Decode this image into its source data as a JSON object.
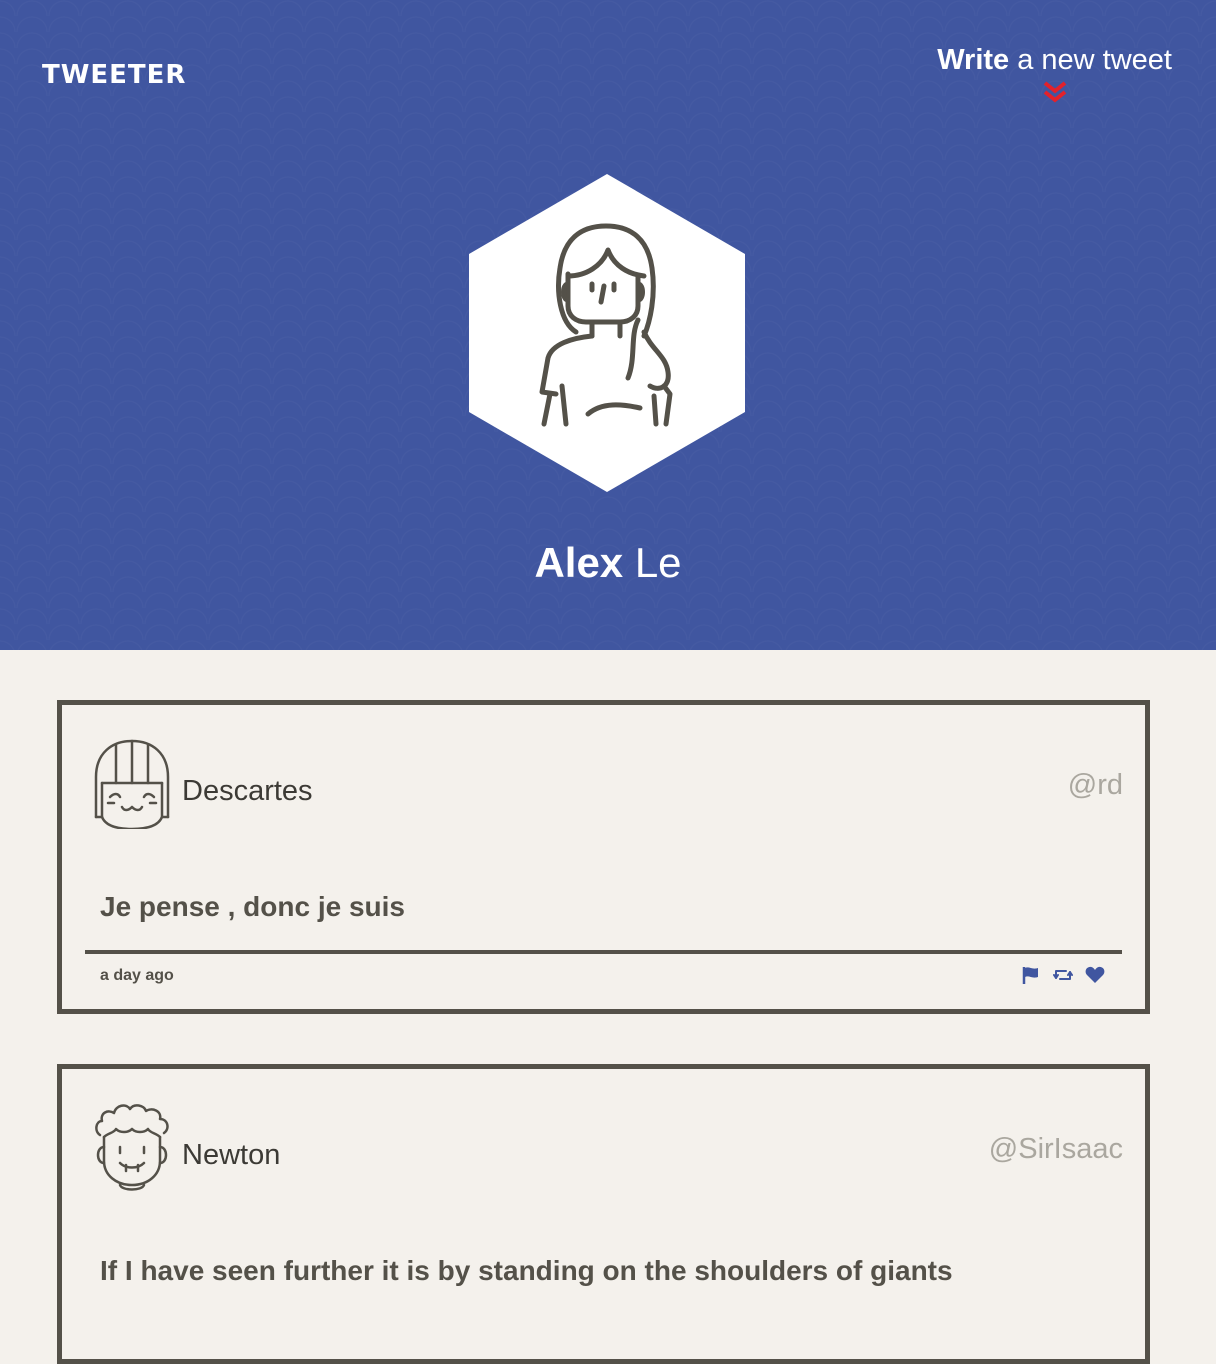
{
  "header": {
    "logo": "TWEETER",
    "compose_strong": "Write",
    "compose_rest": " a new tweet",
    "compose_icon": "chevron-double-down-icon",
    "accent_color": "#e3212b",
    "background_color": "#4056a0"
  },
  "profile": {
    "first_name": "Alex",
    "last_name": " Le",
    "avatar_icon": "woman-long-hair-avatar-icon"
  },
  "tweets": [
    {
      "author": "Descartes",
      "handle": "@rd",
      "avatar_icon": "girl-bangs-avatar-icon",
      "content": "Je pense , donc je suis",
      "time": "a day ago",
      "actions": [
        "flag-icon",
        "retweet-icon",
        "heart-icon"
      ]
    },
    {
      "author": "Newton",
      "handle": "@SirIsaac",
      "avatar_icon": "curly-hair-avatar-icon",
      "content": "If I have seen further it is by standing on the shoulders of giants"
    }
  ],
  "colors": {
    "page_background": "#f4f1ec",
    "ink": "#545149",
    "handle": "#aaa79f",
    "action": "#4056a0"
  }
}
